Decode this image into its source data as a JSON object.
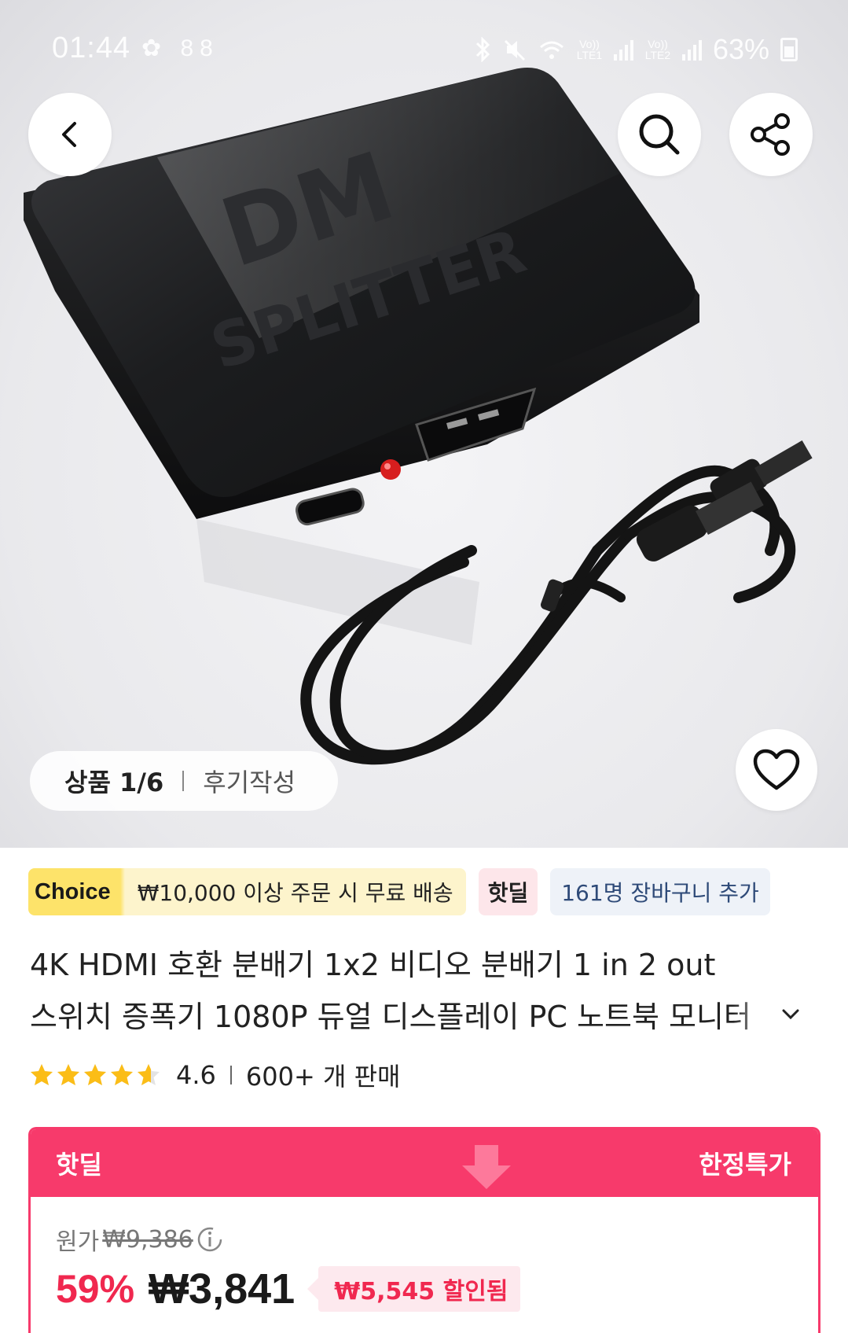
{
  "status": {
    "time": "01:44",
    "left_icons": "✿ 88",
    "lte1": "Vo)) LTE1",
    "lte2": "Vo)) LTE2",
    "battery": "63%"
  },
  "hero": {
    "image_counter": "상품 1/6",
    "review_link": "후기작성"
  },
  "tags": {
    "choice_badge": "Choice",
    "shipping": "₩10,000 이상 주문 시 무료 배송",
    "hot_deal": "핫딜",
    "cart_count": "161명 장바구니 추가"
  },
  "product": {
    "title_line1": "4K HDMI 호환 분배기 1x2 비디오 분배기 1 in 2 out",
    "title_line2": "스위치 증폭기 1080P 듀얼 디스플레이 PC 노트북 모니터",
    "rating_value": 4.6,
    "rating": "4.6",
    "sold": "600+ 개 판매"
  },
  "price": {
    "banner_left": "핫딜",
    "banner_right": "한정특가",
    "original_label": "원가",
    "original_price": "₩9,386",
    "discount_percent": "59%",
    "final_price": "₩3,841",
    "saved": "₩5,545 할인됨"
  },
  "colors": {
    "accent": "#f73a6b",
    "discount_red": "#f0284f",
    "choice_yellow": "#fde36a",
    "star": "#fbbd17"
  },
  "icons": [
    "back-icon",
    "search-icon",
    "share-icon",
    "heart-icon",
    "chevron-down-icon",
    "info-icon",
    "star-icon"
  ]
}
